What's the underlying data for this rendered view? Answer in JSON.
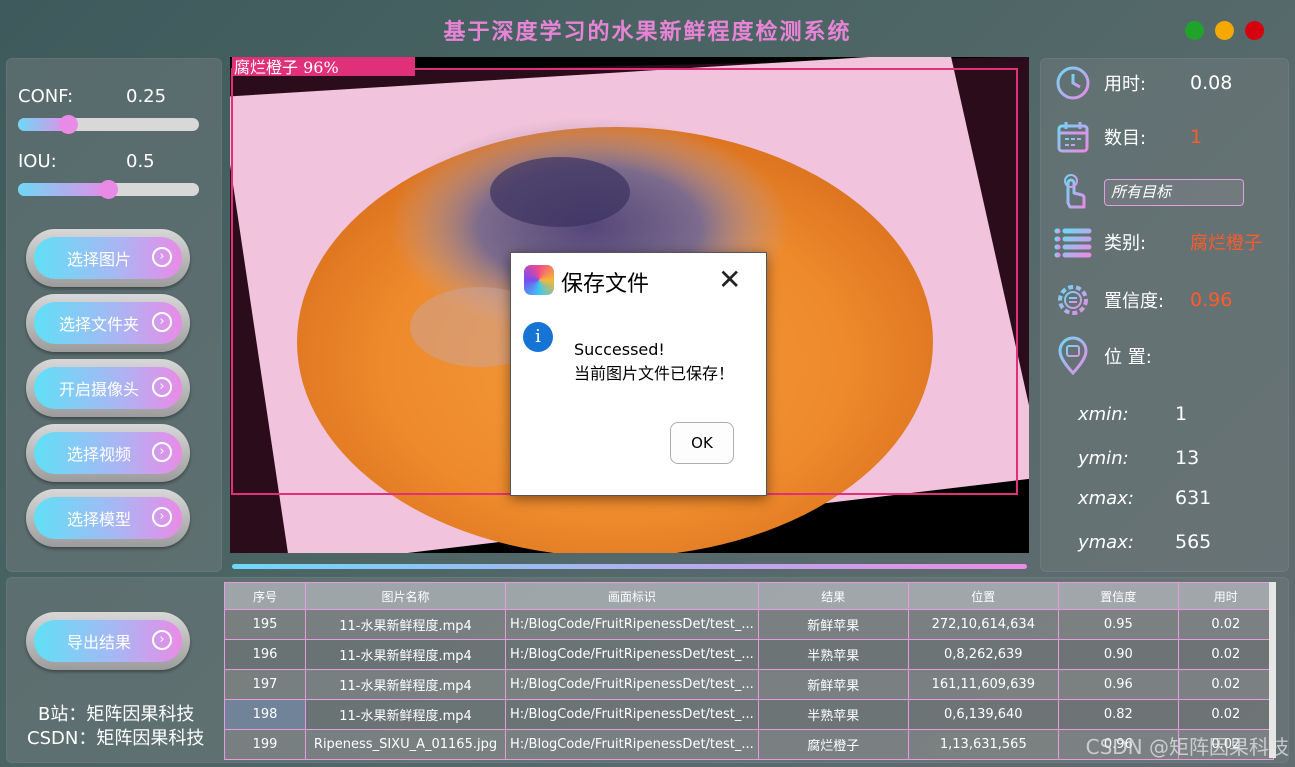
{
  "window": {
    "title": "基于深度学习的水果新鲜程度检测系统"
  },
  "controls": {
    "conf_label": "CONF:",
    "conf_value": "0.25",
    "conf_level": 0.28,
    "iou_label": "IOU:",
    "iou_value": "0.5",
    "iou_level": 0.5
  },
  "buttons": [
    "选择图片",
    "选择文件夹",
    "开启摄像头",
    "选择视频",
    "选择模型"
  ],
  "export_button": "导出结果",
  "credits": {
    "bilibili": "B站：矩阵因果科技",
    "csdn": "CSDN：矩阵因果科技"
  },
  "detection": {
    "label": "腐烂橙子  96%"
  },
  "info": {
    "time_label": "用时:",
    "time_value": "0.08",
    "count_label": "数目:",
    "count_value": "1",
    "target_select": "所有目标",
    "class_label": "类别:",
    "class_value": "腐烂橙子",
    "conf_label": "置信度:",
    "conf_value": "0.96",
    "pos_label": "位 置:",
    "xmin_label": "xmin:",
    "xmin": "1",
    "ymin_label": "ymin:",
    "ymin": "13",
    "xmax_label": "xmax:",
    "xmax": "631",
    "ymax_label": "ymax:",
    "ymax": "565"
  },
  "dialog": {
    "title": "保存文件",
    "line1": "Successed!",
    "line2": "当前图片文件已保存！",
    "ok": "OK"
  },
  "table": {
    "headers": [
      "序号",
      "图片名称",
      "画面标识",
      "结果",
      "位置",
      "置信度",
      "用时"
    ],
    "rows": [
      [
        "195",
        "11-水果新鲜程度.mp4",
        "H:/BlogCode/FruitRipenessDet/test_...",
        "新鲜苹果",
        "272,10,614,634",
        "0.95",
        "0.02"
      ],
      [
        "196",
        "11-水果新鲜程度.mp4",
        "H:/BlogCode/FruitRipenessDet/test_...",
        "半熟苹果",
        "0,8,262,639",
        "0.90",
        "0.02"
      ],
      [
        "197",
        "11-水果新鲜程度.mp4",
        "H:/BlogCode/FruitRipenessDet/test_...",
        "新鲜苹果",
        "161,11,609,639",
        "0.96",
        "0.02"
      ],
      [
        "198",
        "11-水果新鲜程度.mp4",
        "H:/BlogCode/FruitRipenessDet/test_...",
        "半熟苹果",
        "0,6,139,640",
        "0.82",
        "0.02"
      ],
      [
        "199",
        "Ripeness_SIXU_A_01165.jpg",
        "H:/BlogCode/FruitRipenessDet/test_...",
        "腐烂橙子",
        "1,13,631,565",
        "0.96",
        "0.02"
      ]
    ]
  },
  "watermark": "CSDN @矩阵因果科技",
  "colors": {
    "accent_pink": "#e884d6",
    "accent_cyan": "#5fe0f7",
    "value_orange": "#ff5a2a",
    "win_green": "#1fa32b",
    "win_yellow": "#f5a800",
    "win_red": "#d6000f"
  }
}
